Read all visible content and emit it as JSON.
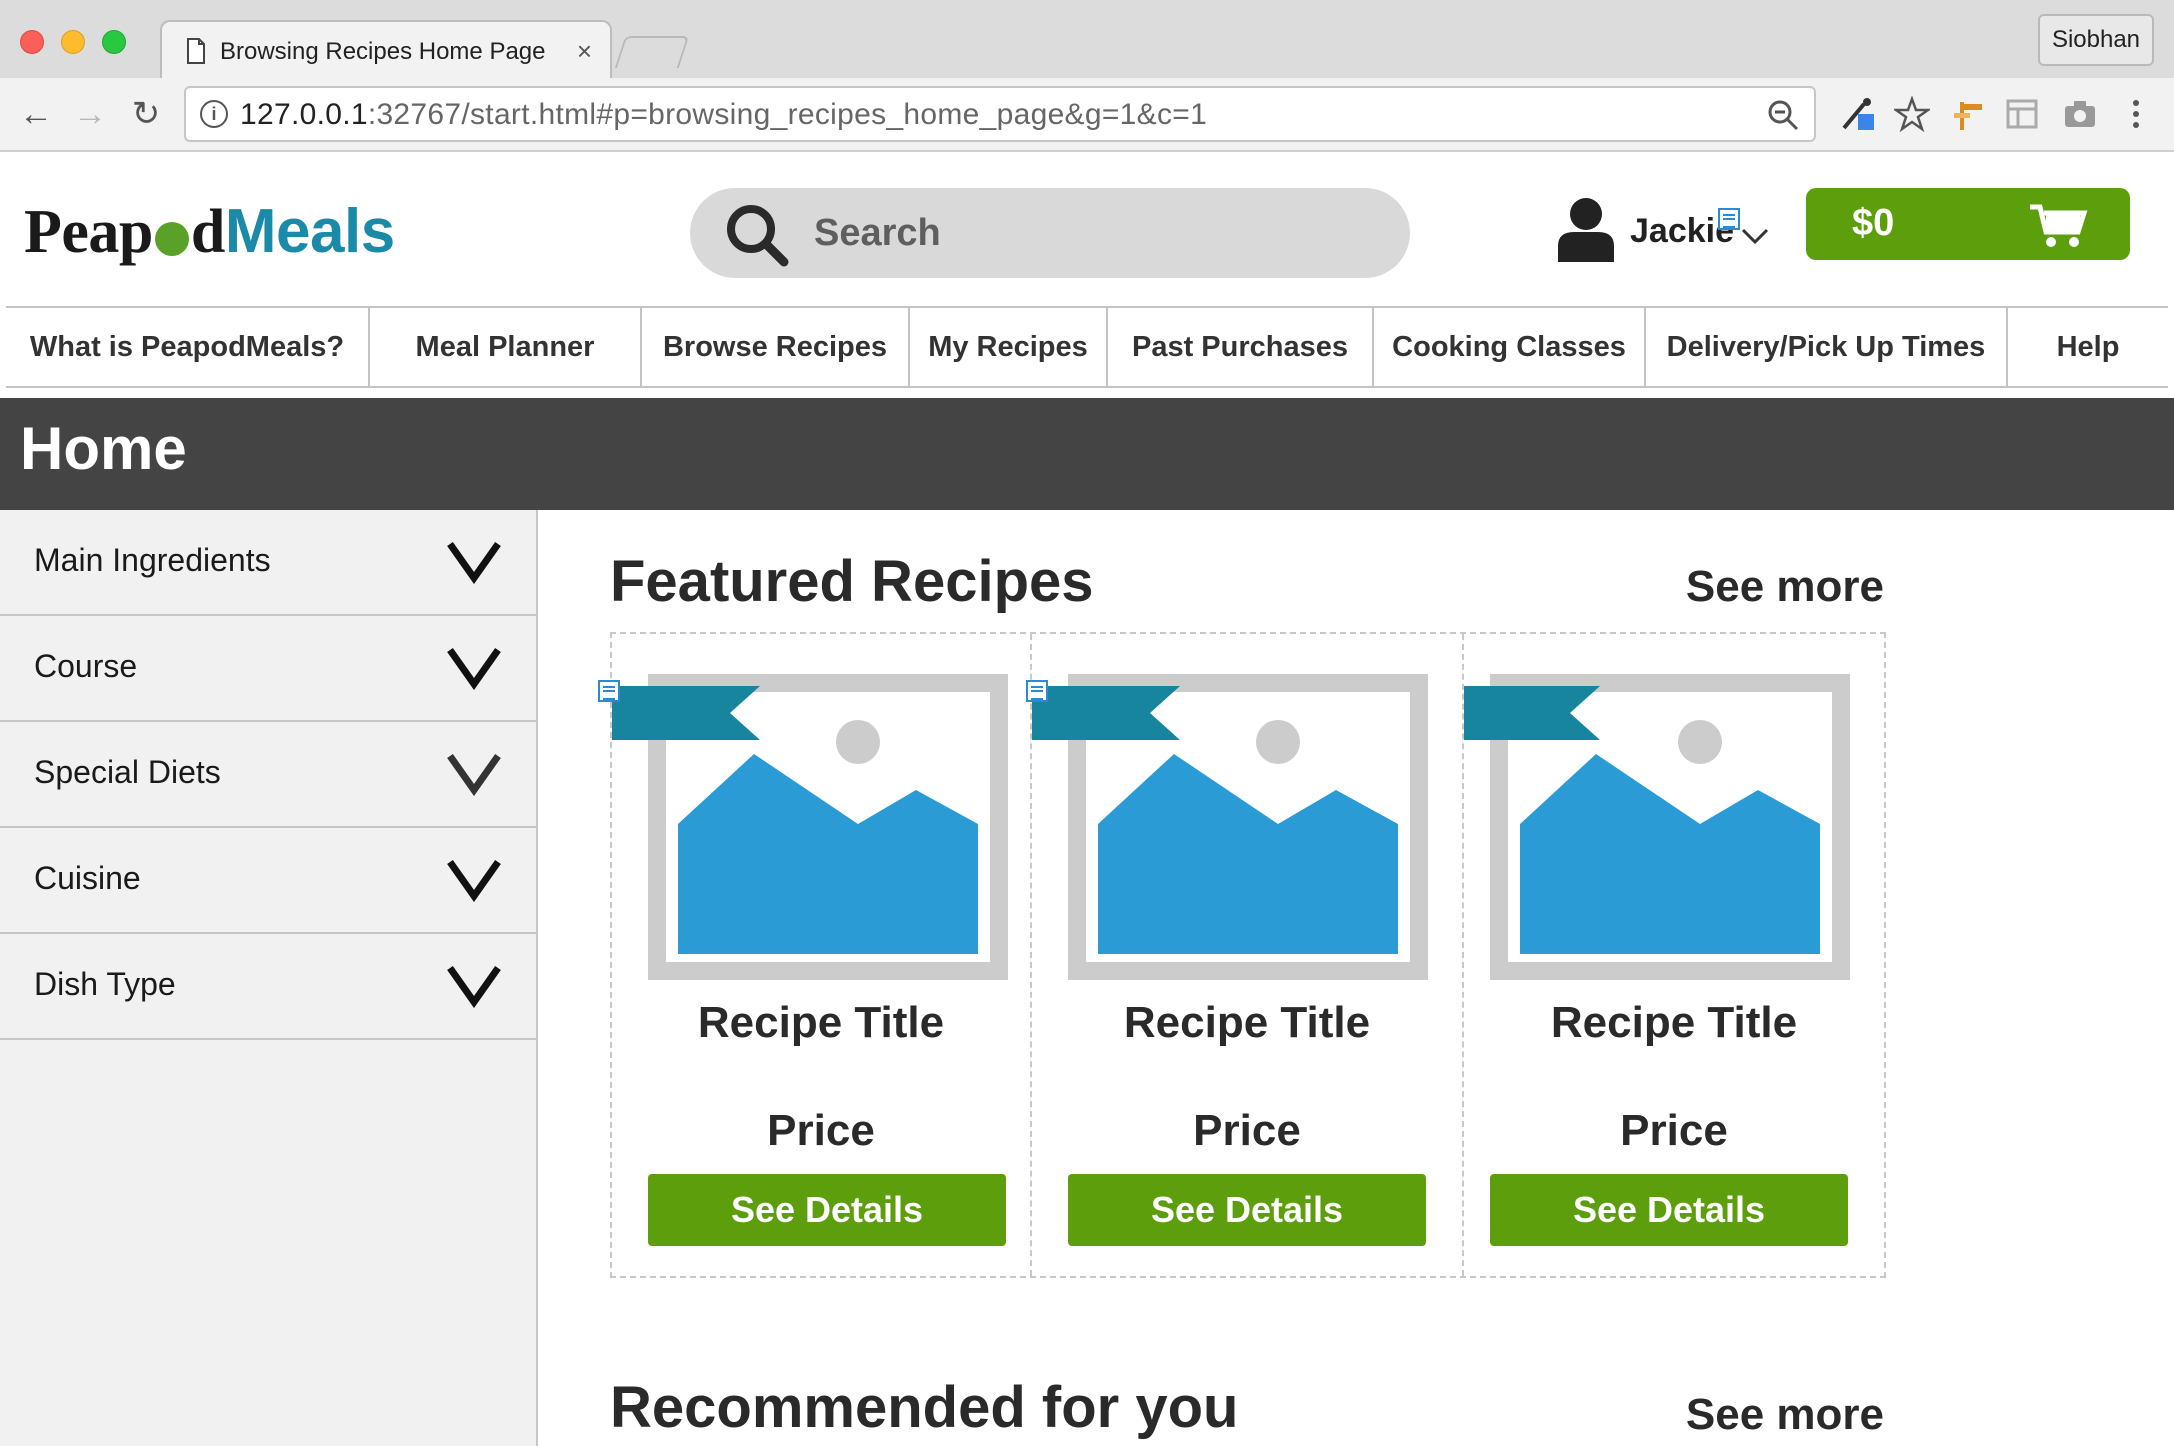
{
  "browser": {
    "tab_title": "Browsing Recipes Home Page",
    "tab_close": "×",
    "profile_name": "Siobhan",
    "url_host": "127.0.0.1",
    "url_rest": ":32767/start.html#p=browsing_recipes_home_page&g=1&c=1",
    "back": "←",
    "forward": "→",
    "reload": "↻",
    "info": "i"
  },
  "header": {
    "logo_part1": "Peap",
    "logo_part2": "d",
    "logo_part3": "Meals",
    "search_placeholder": "Search",
    "user_name": "Jackie",
    "cart_amount": "$0"
  },
  "nav": {
    "items": [
      {
        "label": "What is PeapodMeals?"
      },
      {
        "label": "Meal Planner"
      },
      {
        "label": "Browse Recipes"
      },
      {
        "label": "My Recipes"
      },
      {
        "label": "Past Purchases"
      },
      {
        "label": "Cooking Classes"
      },
      {
        "label": "Delivery/Pick Up Times"
      },
      {
        "label": "Help"
      }
    ]
  },
  "page": {
    "title": "Home"
  },
  "sidebar": {
    "filters": [
      {
        "label": "Main Ingredients"
      },
      {
        "label": "Course"
      },
      {
        "label": "Special Diets"
      },
      {
        "label": "Cuisine"
      },
      {
        "label": "Dish Type"
      }
    ]
  },
  "featured": {
    "title": "Featured Recipes",
    "see_more": "See more",
    "cards": [
      {
        "title": "Recipe Title",
        "price": "Price",
        "button": "See Details"
      },
      {
        "title": "Recipe Title",
        "price": "Price",
        "button": "See Details"
      },
      {
        "title": "Recipe Title",
        "price": "Price",
        "button": "See Details"
      }
    ]
  },
  "recommended": {
    "title": "Recommended for you",
    "see_more": "See more"
  },
  "colors": {
    "accent_green": "#5c9e0c",
    "brand_teal": "#1a8aa8",
    "header_band": "#444444",
    "image_blue": "#2a9bd4"
  }
}
